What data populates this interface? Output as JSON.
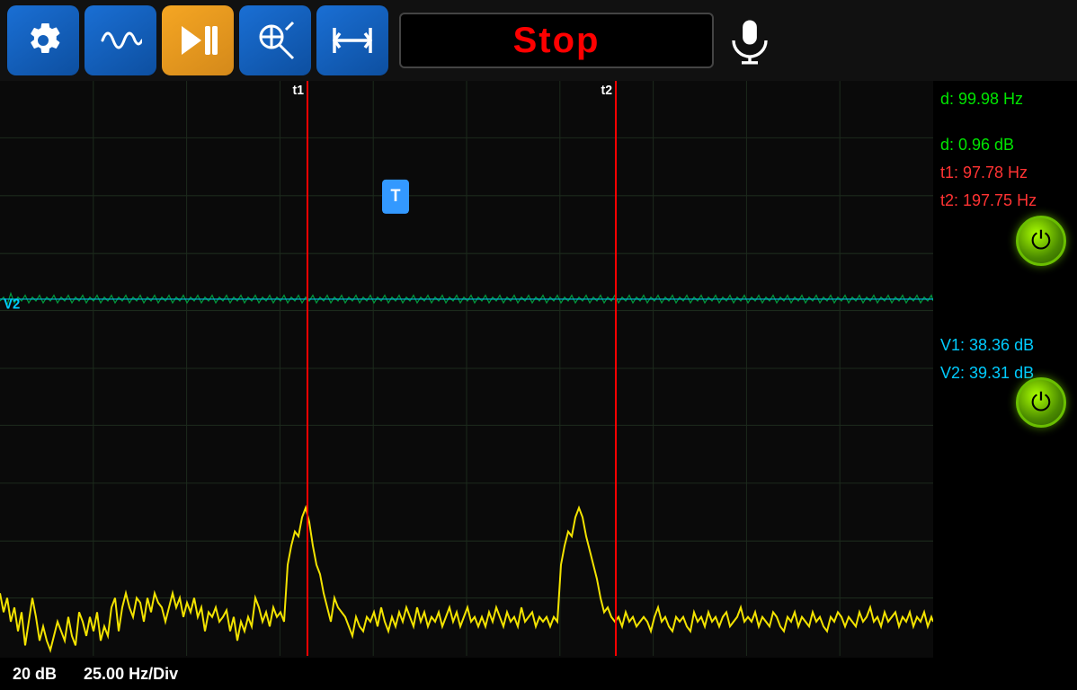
{
  "toolbar": {
    "buttons": [
      {
        "id": "settings",
        "label": "⚙",
        "style": "blue",
        "name": "settings-button"
      },
      {
        "id": "wave",
        "label": "~",
        "style": "blue",
        "name": "wave-button"
      },
      {
        "id": "play-pause",
        "label": "▶⏸",
        "style": "orange",
        "name": "play-pause-button"
      },
      {
        "id": "zoom",
        "label": "⊕",
        "style": "blue",
        "name": "zoom-button"
      },
      {
        "id": "fit",
        "label": "↔",
        "style": "blue",
        "name": "fit-button"
      }
    ],
    "stop_label": "Stop",
    "mic_label": "🎙"
  },
  "stats": {
    "d_hz": "d: 99.98 Hz",
    "d_db": "d: 0.96 dB",
    "t1_hz": "t1: 97.78 Hz",
    "t2_hz": "t2: 197.75 Hz",
    "v1_db": "V1: 38.36 dB",
    "v2_db": "V2: 39.31 dB"
  },
  "cursors": {
    "t1_x_pct": 33,
    "t2_x_pct": 66,
    "t1_label": "t1",
    "t2_label": "t2"
  },
  "status_bar": {
    "scale_db": "20 dB",
    "scale_hz": "25.00 Hz/Div"
  },
  "chart": {
    "grid_color": "#1a1a1a",
    "top_wave_color": "#00cc44",
    "top_wave_y_pct": 36,
    "bottom_wave_color": "#ffee00",
    "v2_label": "V2"
  }
}
